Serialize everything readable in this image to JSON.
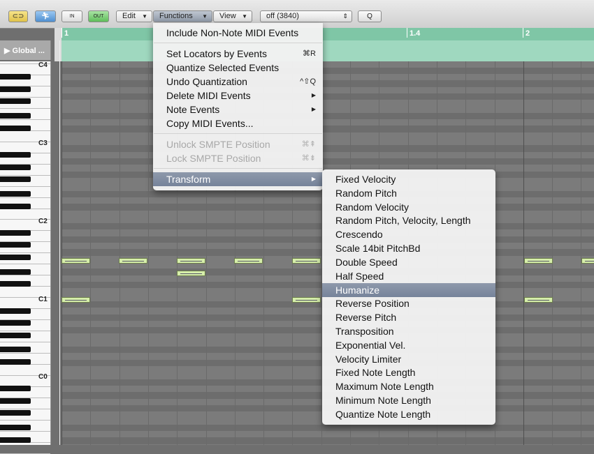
{
  "toolbar": {
    "edit_label": "Edit",
    "functions_label": "Functions",
    "view_label": "View",
    "quantize_value": "off (3840)",
    "in_label": "IN",
    "out_label": "OUT"
  },
  "ruler": {
    "global_label": "Global ...",
    "markers": [
      "1",
      "1.4",
      "2"
    ]
  },
  "keyboard": {
    "labels": [
      "C4",
      "C3",
      "C2",
      "C1",
      "C0"
    ]
  },
  "functions_menu": {
    "items": [
      {
        "label": "Include Non-Note MIDI Events",
        "shortcut": ""
      },
      {
        "label": "Set Locators by Events",
        "shortcut": "⌘R"
      },
      {
        "label": "Quantize Selected Events",
        "shortcut": ""
      },
      {
        "label": "Undo Quantization",
        "shortcut": "^⇧Q"
      },
      {
        "label": "Delete MIDI Events",
        "shortcut": "▶"
      },
      {
        "label": "Note Events",
        "shortcut": "▶"
      },
      {
        "label": "Copy MIDI Events...",
        "shortcut": ""
      },
      {
        "label": "Unlock SMPTE Position",
        "shortcut": "⌘⇞"
      },
      {
        "label": "Lock SMPTE Position",
        "shortcut": "⌘⇟"
      },
      {
        "label": "Transform",
        "shortcut": "▶"
      }
    ]
  },
  "transform_menu": {
    "items": [
      "Fixed Velocity",
      "Random Pitch",
      "Random Velocity",
      "Random Pitch, Velocity, Length",
      "Crescendo",
      "Scale 14bit PitchBd",
      "Double Speed",
      "Half Speed",
      "Humanize",
      "Reverse Position",
      "Reverse Pitch",
      "Transposition",
      "Exponential Vel.",
      "Velocity Limiter",
      "Fixed Note Length",
      "Maximum Note Length",
      "Minimum Note Length",
      "Quantize Note Length"
    ],
    "highlighted": "Humanize"
  }
}
